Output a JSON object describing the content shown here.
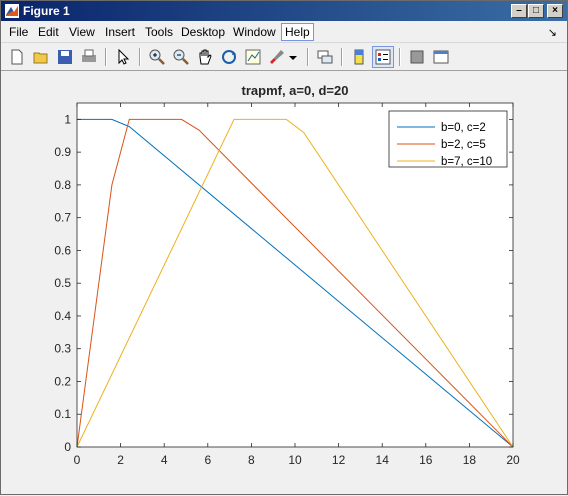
{
  "window": {
    "title": "Figure 1"
  },
  "menu": [
    "File",
    "Edit",
    "View",
    "Insert",
    "Tools",
    "Desktop",
    "Window",
    "Help"
  ],
  "active_menu": "Help",
  "toolbar_icons": [
    "new-figure-icon",
    "open-file-icon",
    "save-icon",
    "print-icon",
    "edit-plot-arrow-icon",
    "zoom-in-icon",
    "zoom-out-icon",
    "pan-hand-icon",
    "rotate-3d-icon",
    "data-cursor-icon",
    "brush-icon",
    "brush-dropdown-icon",
    "link-plot-icon",
    "colorbar-icon",
    "legend-icon",
    "hide-plot-tools-icon",
    "show-plot-tools-icon"
  ],
  "chart_data": {
    "type": "line",
    "title": "trapmf, a=0, d=20",
    "xlim": [
      0,
      20
    ],
    "ylim": [
      0,
      1.05
    ],
    "xticks": [
      0,
      2,
      4,
      6,
      8,
      10,
      12,
      14,
      16,
      18,
      20
    ],
    "yticks": [
      0,
      0.1,
      0.2,
      0.3,
      0.4,
      0.5,
      0.6,
      0.7,
      0.8,
      0.9,
      1
    ],
    "xlabel": "",
    "ylabel": "",
    "grid": false,
    "legend_position": "top-right",
    "series": [
      {
        "name": "b=0, c=2",
        "color": "#0072bd",
        "x": [
          0,
          1.6,
          2.4,
          20
        ],
        "y": [
          1,
          1,
          0.978,
          0
        ]
      },
      {
        "name": "b=2, c=5",
        "color": "#d95319",
        "x": [
          0,
          1.6,
          2.4,
          4.8,
          5.6,
          20
        ],
        "y": [
          0,
          0.8,
          1,
          1,
          0.967,
          0
        ]
      },
      {
        "name": "b=7, c=10",
        "color": "#edb120",
        "x": [
          0,
          7.2,
          9.6,
          10.4,
          20
        ],
        "y": [
          0,
          1,
          1,
          0.96,
          0
        ]
      }
    ]
  }
}
